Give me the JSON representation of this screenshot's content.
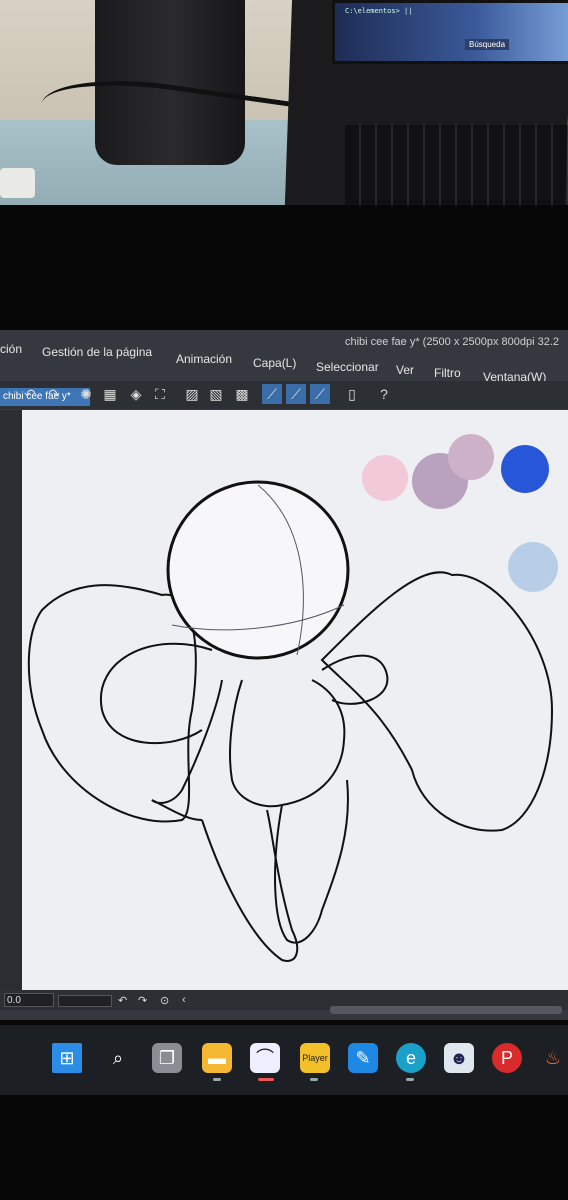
{
  "app": {
    "title": "chibi cee fae y* (2500 x 2500px 800dpi 32.2",
    "menu": [
      "ción",
      "Gestión de la página",
      "Animación",
      "Capa(L)",
      "Seleccionar",
      "Ver",
      "Filtro",
      "Ventana(W)"
    ],
    "tab_label": "chibi cee fae y*",
    "zoom_value": "0.0"
  },
  "laptop": {
    "terminal_text": "C:\\elementos> ||",
    "search_label": "Búsqueda"
  },
  "palette_colors": [
    "#f2c9d6",
    "#b9a2bd",
    "#cdb1c8",
    "#2756d8",
    "#b8cde6"
  ],
  "taskbar": {
    "icons": [
      "windows-start-icon",
      "search-icon",
      "task-view-icon",
      "file-explorer-icon",
      "clip-studio-icon",
      "pot-player-icon",
      "notepad-icon",
      "edge-icon",
      "mascot-app-icon",
      "psiphon-icon",
      "fire-app-icon"
    ],
    "player_label": "Player"
  }
}
